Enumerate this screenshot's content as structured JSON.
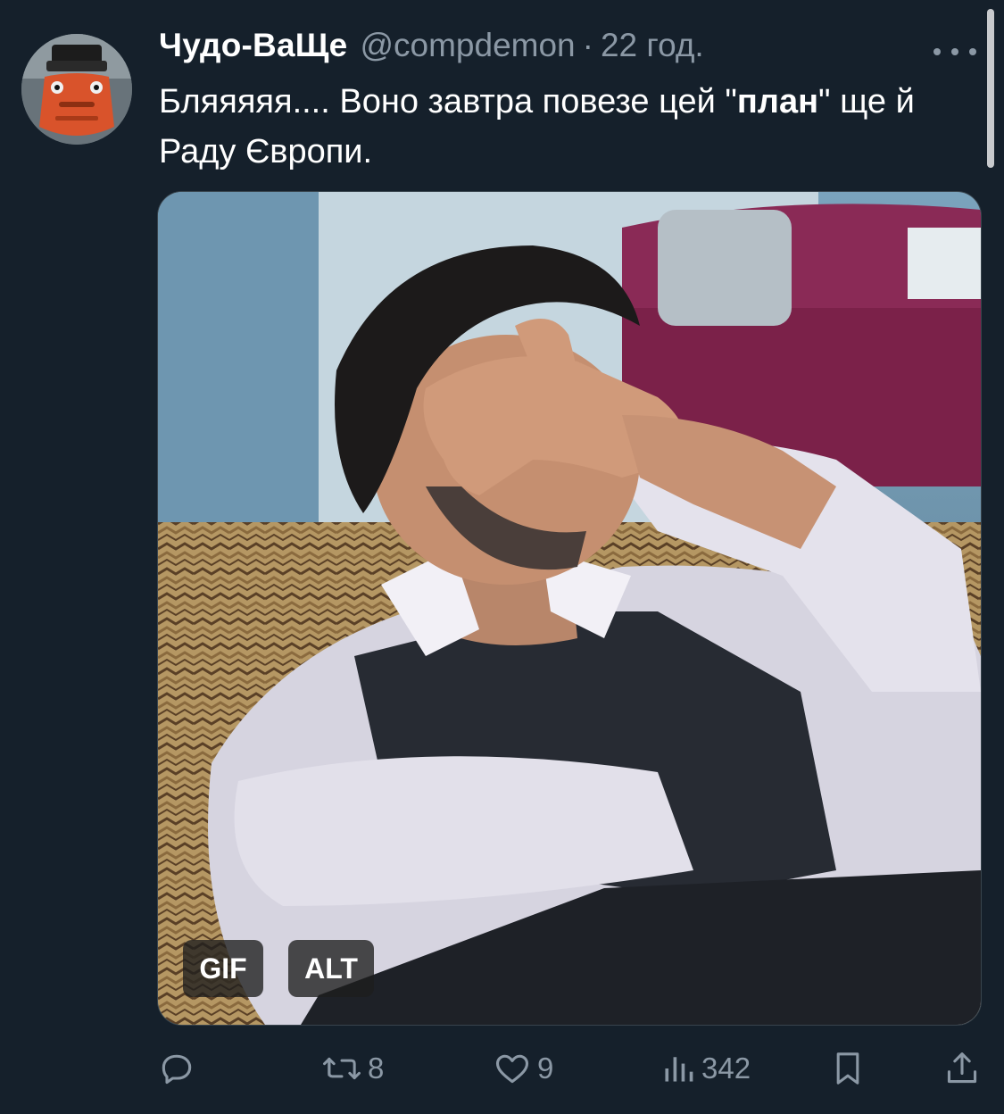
{
  "tweet": {
    "author": {
      "display_name": "Чудо-ВаЩе",
      "handle": "@compdemon",
      "separator": "·",
      "timestamp": "22 год."
    },
    "text": {
      "part1": "Бляяяяя.... Воно завтра повезе цей \"",
      "bold": "план",
      "part2": "\" ще й Раду Європи."
    },
    "media": {
      "type": "gif",
      "badges": {
        "gif_label": "GIF",
        "alt_label": "ALT"
      }
    },
    "actions": {
      "reply": {
        "icon": "reply-icon",
        "count": ""
      },
      "retweet": {
        "icon": "retweet-icon",
        "count": "8"
      },
      "like": {
        "icon": "heart-icon",
        "count": "9"
      },
      "views": {
        "icon": "views-icon",
        "count": "342"
      },
      "bookmark": {
        "icon": "bookmark-icon"
      },
      "share": {
        "icon": "share-icon"
      }
    }
  },
  "colors": {
    "background": "#15202b",
    "text_primary": "#ffffff",
    "text_secondary": "#8b98a5",
    "border": "#38444d"
  }
}
